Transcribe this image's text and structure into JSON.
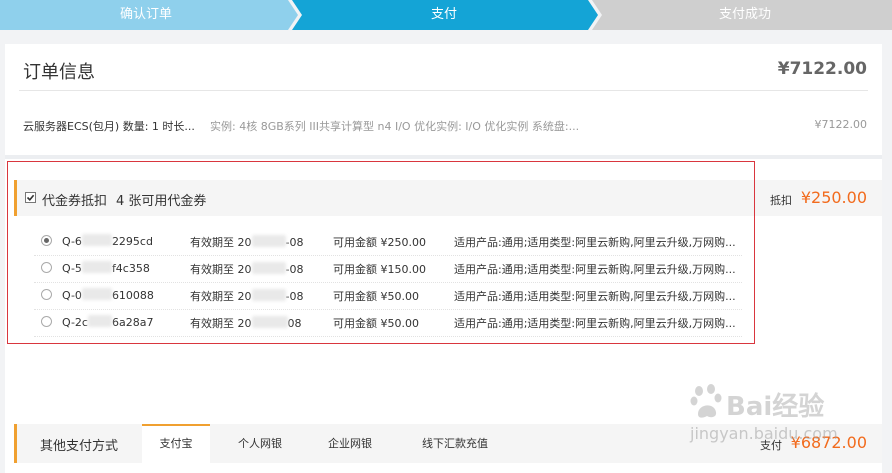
{
  "steps": [
    {
      "label": "确认订单",
      "state": "done",
      "color": "#8fd0ec"
    },
    {
      "label": "支付",
      "state": "current",
      "color": "#14a4d6"
    },
    {
      "label": "支付成功",
      "state": "todo",
      "color": "#cfcfcf"
    }
  ],
  "order": {
    "title": "订单信息",
    "total": "¥7122.00",
    "product_name": "云服务器ECS(包月) 数量: 1 时长...",
    "product_spec": "实例: 4核 8GB系列 III共享计算型 n4 I/O 优化实例: I/O 优化实例 系统盘:...",
    "product_price": "¥7122.00"
  },
  "voucher": {
    "checked": true,
    "label": "代金券抵扣",
    "count_text": "4 张可用代金券",
    "deduct_label": "抵扣",
    "deduct_amount": "¥250.00",
    "items": [
      {
        "selected": true,
        "code_prefix": "Q-6",
        "code_suffix": "2295cd",
        "valid_prefix": "有效期至 20",
        "valid_suffix": "-08",
        "amount": "可用金额 ¥250.00",
        "scope": "适用产品:通用;适用类型:阿里云新购,阿里云升级,万网购..."
      },
      {
        "selected": false,
        "code_prefix": "Q-5",
        "code_suffix": "f4c358",
        "valid_prefix": "有效期至 20",
        "valid_suffix": "-08",
        "amount": "可用金额 ¥150.00",
        "scope": "适用产品:通用;适用类型:阿里云新购,阿里云升级,万网购..."
      },
      {
        "selected": false,
        "code_prefix": "Q-0",
        "code_suffix": "610088",
        "valid_prefix": "有效期至 20",
        "valid_suffix": "-08",
        "amount": "可用金额 ¥50.00",
        "scope": "适用产品:通用;适用类型:阿里云新购,阿里云升级,万网购..."
      },
      {
        "selected": false,
        "code_prefix": "Q-2c",
        "code_suffix": "6a28a7",
        "valid_prefix": "有效期至 20",
        "valid_suffix": "08",
        "amount": "可用金额 ¥50.00",
        "scope": "适用产品:通用;适用类型:阿里云新购,阿里云升级,万网购..."
      }
    ]
  },
  "payment": {
    "title": "其他支付方式",
    "tabs": [
      {
        "label": "支付宝",
        "active": true
      },
      {
        "label": "个人网银",
        "active": false
      },
      {
        "label": "企业网银",
        "active": false
      },
      {
        "label": "线下汇款充值",
        "active": false
      }
    ],
    "total_label": "支付",
    "total_amount": "¥6872.00"
  },
  "watermark": {
    "brand": "Bai经验",
    "url": "jingyan.baidu.com"
  },
  "colors": {
    "accent_orange": "#f26b1d",
    "section_bar": "#f0a030",
    "highlight_border": "#d9363e"
  }
}
